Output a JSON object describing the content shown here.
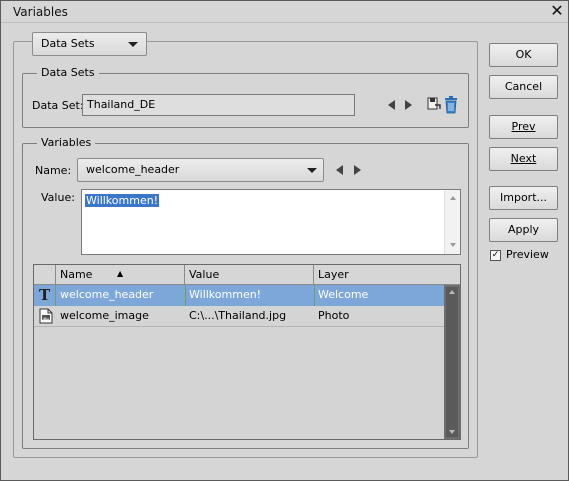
{
  "window": {
    "title": "Variables",
    "close_glyph": "✕"
  },
  "data_sets_dropdown": {
    "label": "Data Sets"
  },
  "data_sets_group": {
    "legend": "Data Sets",
    "field_label": "Data Set:",
    "value": "Thailand_DE"
  },
  "variables_group": {
    "legend": "Variables",
    "name_label": "Name:",
    "name_value": "welcome_header",
    "value_label": "Value:",
    "value_text": "Willkommen!"
  },
  "table": {
    "columns": [
      {
        "label": "Name",
        "sort": "▲"
      },
      {
        "label": "Value"
      },
      {
        "label": "Layer"
      }
    ],
    "rows": [
      {
        "icon": "text-layer-icon",
        "icon_glyph": "T",
        "name": "welcome_header",
        "value": "Willkommen!",
        "layer": "Welcome",
        "selected": true
      },
      {
        "icon": "image-layer-icon",
        "name": "welcome_image",
        "value": "C:\\...\\Thailand.jpg",
        "layer": "Photo",
        "selected": false
      }
    ]
  },
  "buttons": {
    "ok": "OK",
    "cancel": "Cancel",
    "prev": "Prev",
    "next": "Next",
    "import": "Import...",
    "apply": "Apply"
  },
  "preview": {
    "label": "Preview",
    "checked": true,
    "check_glyph": "✓"
  },
  "colors": {
    "selection": "#7da7d9",
    "text_selection": "#3b76c9",
    "scrollbar": "#6e6e6e"
  }
}
